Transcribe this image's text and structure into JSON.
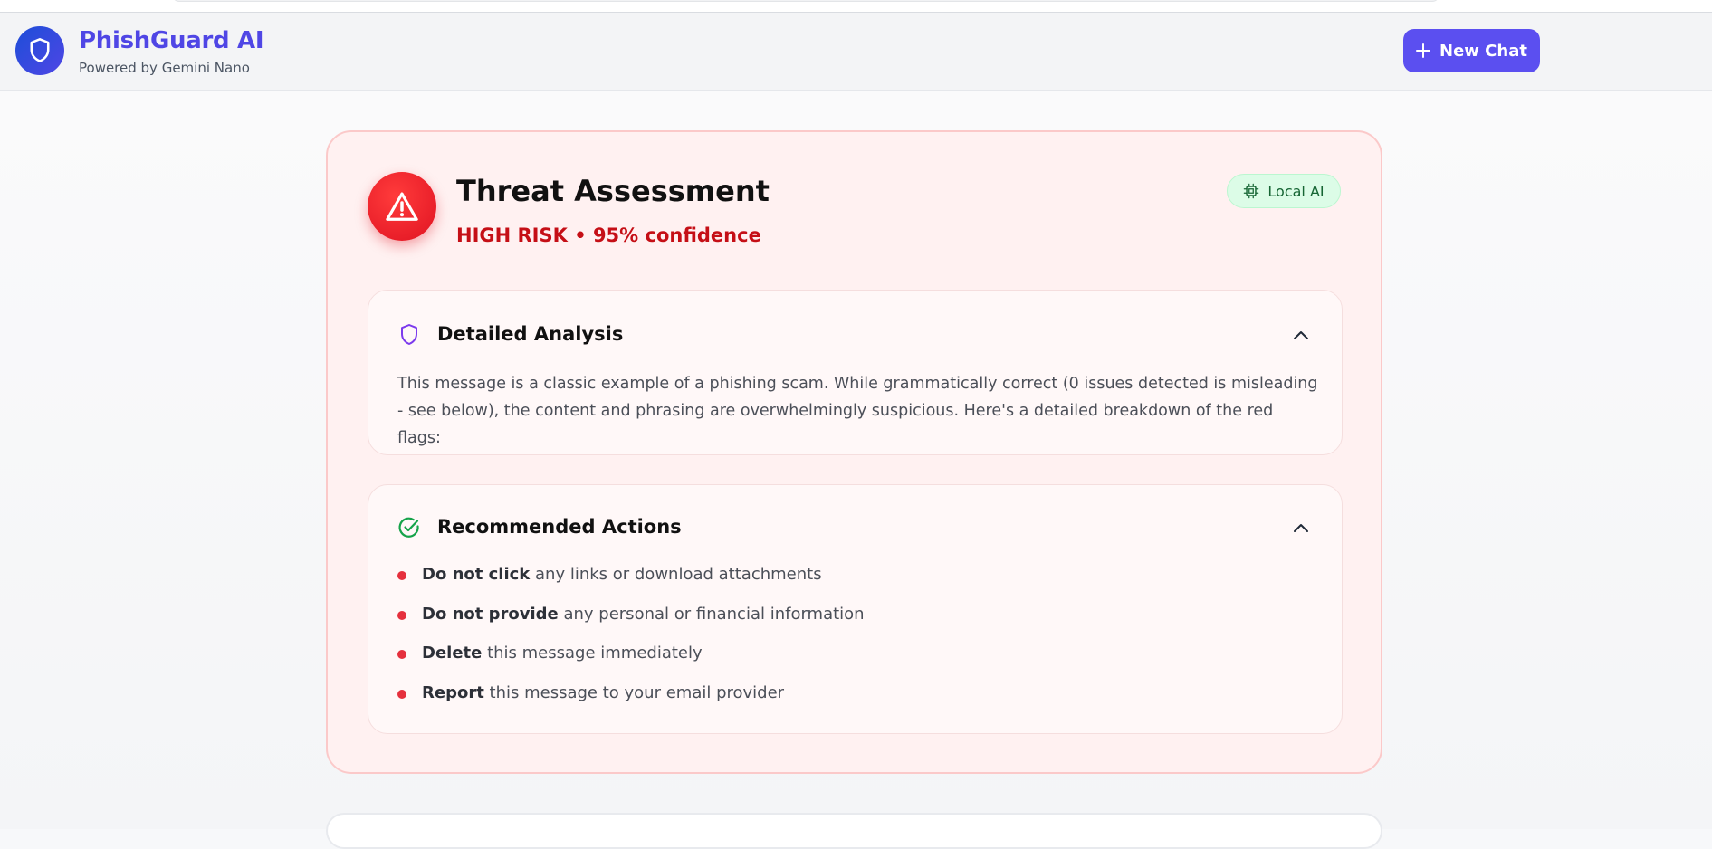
{
  "header": {
    "brand_title": "PhishGuard AI",
    "brand_subtitle": "Powered by Gemini Nano",
    "new_chat_label": "New Chat",
    "logo_icon": "shield-icon"
  },
  "assessment": {
    "title": "Threat Assessment",
    "risk_line": "HIGH RISK • 95% confidence",
    "risk_level": "HIGH RISK",
    "confidence_percent": 95,
    "badge_label": "Local AI",
    "status_icon": "warning-triangle-icon",
    "badge_icon": "cpu-chip-icon"
  },
  "analysis": {
    "title": "Detailed Analysis",
    "icon": "shield-outline-icon",
    "text": "This message is a classic example of a phishing scam. While grammatically correct (0 issues detected is misleading - see below), the content and phrasing are overwhelmingly suspicious. Here's a detailed breakdown of the red flags:"
  },
  "actions": {
    "title": "Recommended Actions",
    "icon": "check-circle-icon",
    "items": [
      {
        "bold": "Do not click",
        "rest": " any links or download attachments"
      },
      {
        "bold": "Do not provide",
        "rest": " any personal or financial information"
      },
      {
        "bold": "Delete",
        "rest": " this message immediately"
      },
      {
        "bold": "Report",
        "rest": " this message to your email provider"
      }
    ]
  },
  "colors": {
    "brand": "#4f46e5",
    "button": "#5b4ff0",
    "danger": "#c50f16",
    "card_bg": "#fff1f1",
    "badge_bg": "#dcfce7",
    "badge_text": "#166534"
  }
}
